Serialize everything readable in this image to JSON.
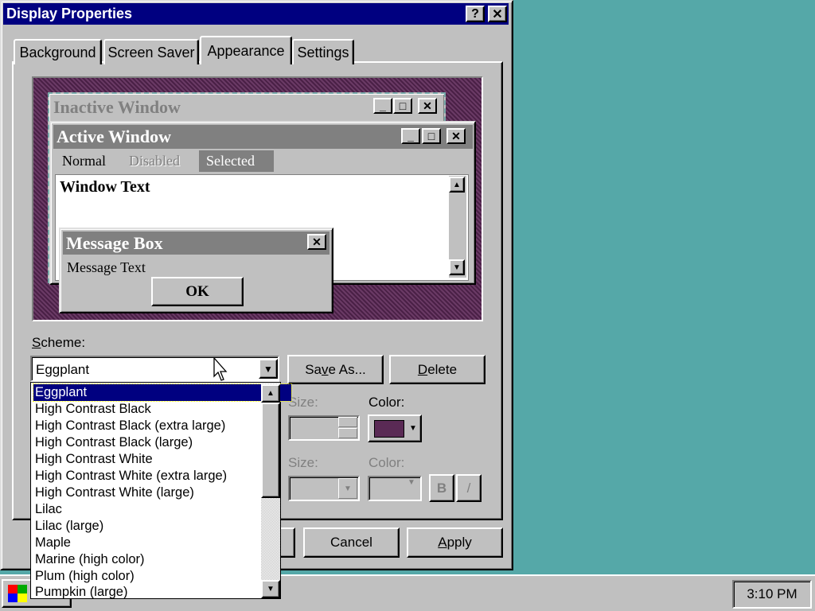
{
  "dialog": {
    "title": "Display Properties",
    "help_btn": "?",
    "close_btn": "✕",
    "tabs": [
      {
        "label": "Background"
      },
      {
        "label": "Screen Saver"
      },
      {
        "label": "Appearance"
      },
      {
        "label": "Settings"
      }
    ]
  },
  "preview": {
    "inactive_title": "Inactive Window",
    "active_title": "Active Window",
    "menu_normal": "Normal",
    "menu_disabled": "Disabled",
    "menu_selected": "Selected",
    "window_text": "Window Text",
    "msgbox_title": "Message Box",
    "msgbox_text": "Message Text",
    "msgbox_ok": "OK"
  },
  "scheme": {
    "label_prefix": "",
    "label_u": "S",
    "label_rest": "cheme:",
    "value": "Eggplant",
    "save_as_pre": "Sa",
    "save_as_u": "v",
    "save_as_post": "e As...",
    "delete_u": "D",
    "delete_rest": "elete",
    "options": [
      "Eggplant",
      "High Contrast Black",
      "High Contrast Black (extra large)",
      "High Contrast Black (large)",
      "High Contrast White",
      "High Contrast White (extra large)",
      "High Contrast White (large)",
      "Lilac",
      "Lilac (large)",
      "Maple",
      "Marine (high color)",
      "Plum (high color)",
      "Pumpkin (large)"
    ]
  },
  "item_controls": {
    "size_label": "Size:",
    "color_label": "Color:",
    "font_size_label": "Size:",
    "font_color_label": "Color:",
    "bold": "B",
    "italic": "/",
    "color_swatch": "#5a2a55"
  },
  "buttons": {
    "cancel": "Cancel",
    "apply_u": "A",
    "apply_rest": "pply"
  },
  "taskbar": {
    "clock": "3:10 PM"
  },
  "colors": {
    "desktop": "#55a8a8",
    "titlebar": "#000080",
    "eggplant": "#5a2a55",
    "inactive_title": "#808080"
  }
}
